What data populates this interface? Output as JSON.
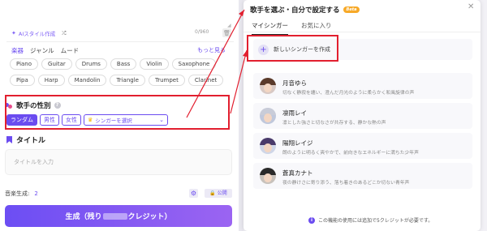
{
  "lyrics": {
    "ai_style_label": "AIスタイル作成",
    "counter": "0/960"
  },
  "style_tabs": [
    "楽器",
    "ジャンル",
    "ムード"
  ],
  "more_link": "もっと見る",
  "chip_rows": [
    [
      "Piano",
      "Guitar",
      "Drums",
      "Bass",
      "Violin",
      "Saxophone"
    ],
    [
      "Pipa",
      "Harp",
      "Mandolin",
      "Triangle",
      "Trumpet",
      "Clarinet"
    ]
  ],
  "gender": {
    "title": "歌手の性別",
    "random": "ランダム",
    "male": "男性",
    "female": "女性",
    "select_singer": "シンガーを選択"
  },
  "title_section": {
    "label": "タイトル",
    "placeholder": "タイトルを入力"
  },
  "generation": {
    "label": "音楽生成:",
    "count": "2",
    "public_label": "公開"
  },
  "generate_button": {
    "prefix": "生成（残り",
    "suffix": "クレジット）"
  },
  "popup": {
    "title": "歌手を選ぶ・自分で設定する",
    "beta": "Beta",
    "tabs": [
      "マイシンガー",
      "お気に入り"
    ],
    "create_label": "新しいシンガーを作成",
    "singers": [
      {
        "name": "月音ゆら",
        "desc": "切なく静寂を纏い、澄んだ月光のように柔らかく和風旋律の声",
        "hair": "#5a3a2a"
      },
      {
        "name": "凛雨レイ",
        "desc": "凛とした強さと切なさが共存する、静かな熱の声",
        "hair": "#c9ccd8"
      },
      {
        "name": "陽翔レイジ",
        "desc": "朗のように明るく爽やかで、前向きなエネルギーに満ちた少年声",
        "hair": "#4a3a6a"
      },
      {
        "name": "蒼真カナト",
        "desc": "夜の静けさに寄り添う、落ち着きのあるどこか切ない青年声",
        "hair": "#2a2a2a"
      }
    ],
    "notice": "この機能の使用には追加で5クレジットが必要です。"
  },
  "colors": {
    "accent": "#6b4cf0",
    "highlight": "#e21f2f",
    "beta": "#f7a928"
  }
}
